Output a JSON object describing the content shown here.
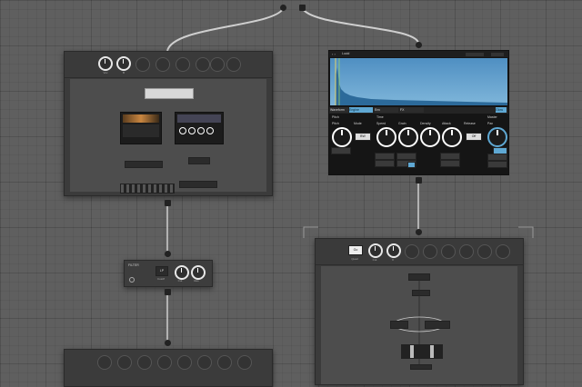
{
  "knob_labels": {
    "top_left": [
      "Vox",
      "B",
      "",
      "",
      "",
      "",
      "",
      ""
    ],
    "top_bottom": [
      "Quad",
      "Cut",
      "II",
      "",
      "",
      "",
      "",
      ""
    ],
    "filter": [
      "Cutoff",
      "Cut",
      "Res"
    ]
  },
  "filter_node": {
    "title": "FILTER",
    "mode": "LP"
  },
  "instrument": {
    "title": "Lucid",
    "tabs": [
      "Waveform",
      "Engine",
      "Env",
      "FX"
    ],
    "selected_tab": "Engine",
    "section_left": "Pitch",
    "section_mid": "Time",
    "section_right": "Master",
    "columns": [
      "Pitch",
      "Mode",
      "Speed",
      "Grain",
      "Density",
      "Attack",
      "Release",
      "Pan"
    ],
    "mode_value": "BW",
    "release_value": "Off",
    "tag": "Glow"
  },
  "bottom_group": {
    "btn_label": "Go"
  },
  "colors": {
    "accent": "#5fa8d3",
    "background": "#5f5f5f",
    "panel": "#3b3b3b"
  }
}
